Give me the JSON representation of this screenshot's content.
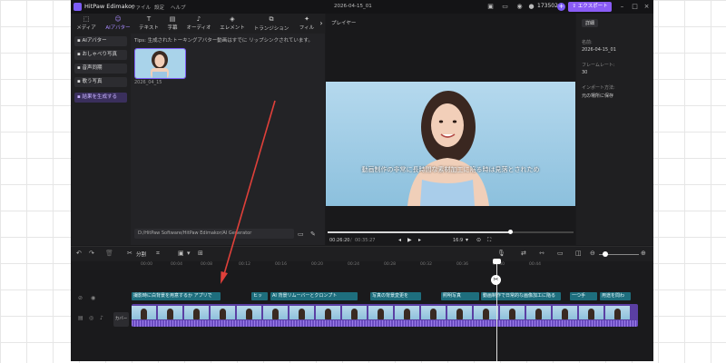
{
  "app": {
    "name": "HitPaw Edimakor",
    "menu": [
      "ファイル",
      "設定",
      "ヘルプ"
    ],
    "window_title": "2026-04-15_01",
    "credits": "173502",
    "export_label": "エクスポート",
    "accent": "#8a5cf6"
  },
  "toolbar": {
    "items": [
      {
        "label": "メディア",
        "icon": "media-icon"
      },
      {
        "label": "AIアバター",
        "icon": "avatar-icon"
      },
      {
        "label": "テキスト",
        "icon": "text-icon"
      },
      {
        "label": "字幕",
        "icon": "caption-icon"
      },
      {
        "label": "オーディオ",
        "icon": "audio-icon"
      },
      {
        "label": "エレメント",
        "icon": "element-icon"
      },
      {
        "label": "トランジション",
        "icon": "transition-icon"
      },
      {
        "label": "フィル",
        "icon": "filter-icon"
      }
    ],
    "active_index": 1
  },
  "sidebar": {
    "items": [
      {
        "label": "AIアバター"
      },
      {
        "label": "おしゃべり写真"
      },
      {
        "label": "音声同期"
      },
      {
        "label": "歌う写真"
      },
      {
        "label": "結果を生成する"
      }
    ],
    "highlight_index": 4
  },
  "media": {
    "tips": "Tips: 生成されたトーキングアバター動画はすでに リップシンクされています。",
    "thumb_caption": "2026_04_15",
    "path": "D:/HitPaw Software/HitPaw Edimakor/AI Generator"
  },
  "player": {
    "title": "プレイヤー",
    "subtitle": "動画制作の非常に長時間な素材加工に陥る時は見落とされため",
    "current_time": "00:26:20",
    "total_time": "00:35:27",
    "progress": 0.745,
    "aspect": "16:9"
  },
  "details": {
    "tab": "詳細",
    "fields": [
      {
        "label": "名前:",
        "value": "2026-04-15_01"
      },
      {
        "label": "フレームレート:",
        "value": "30"
      },
      {
        "label": "インポート方法:",
        "value": "元の場所に保存"
      }
    ]
  },
  "timeline": {
    "split_label": "分割",
    "cover_label": "カバー",
    "ticks": [
      "00:00",
      "00:04",
      "00:08",
      "00:12",
      "00:16",
      "00:20",
      "00:24",
      "00:28",
      "00:32",
      "00:36",
      "00:40",
      "00:44"
    ],
    "subtitles": [
      "撮影時に白背景を用意するか アプリで",
      "AI 背景リムーバーとクロンプト",
      "写真の背景変更を",
      "動画制作で日常的な画像加工に陥る",
      "一つ手",
      "用途を問わ"
    ],
    "subtitle_small": [
      "ヒッ",
      "照明写真",
      "照明写真"
    ]
  }
}
